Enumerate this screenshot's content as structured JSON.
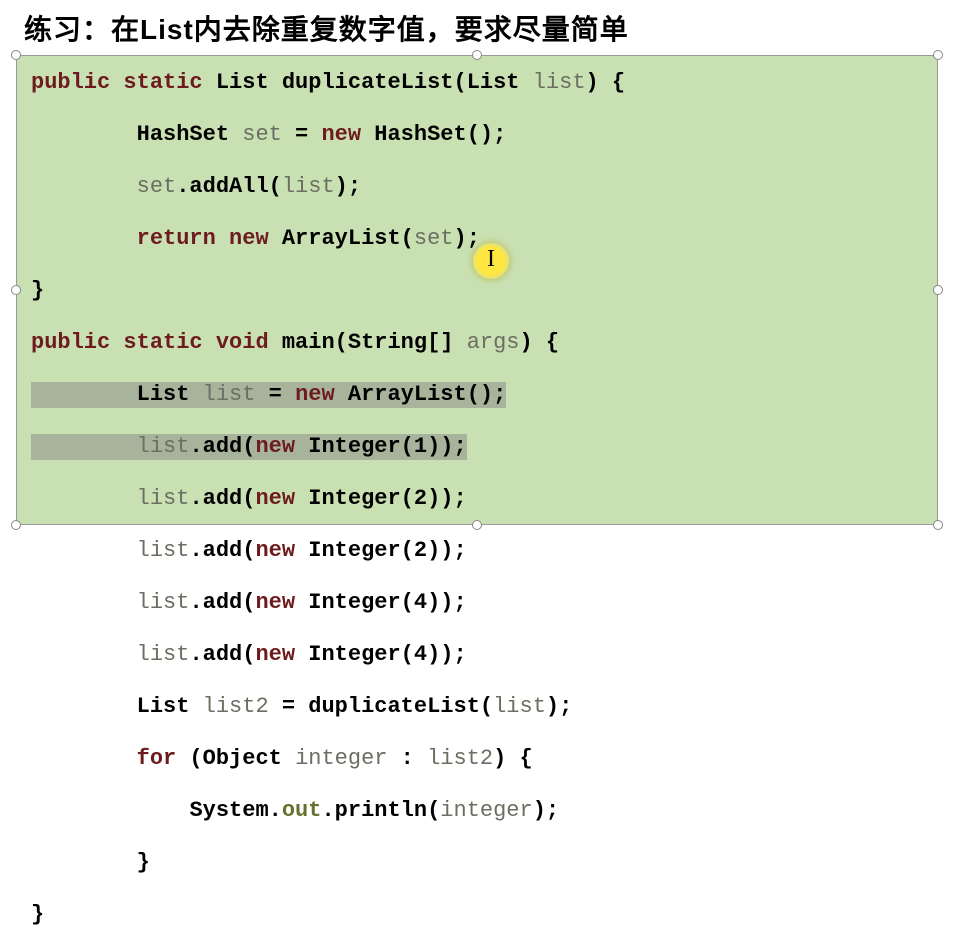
{
  "title": "练习：在List内去除重复数字值，要求尽量简单",
  "code": {
    "l1": {
      "kw1": "public",
      "kw2": "static",
      "type1": "List",
      "name": "duplicateList",
      "lp": "(",
      "type2": "List",
      "param": "list",
      "rp": ") {"
    },
    "l2": {
      "indent": "        ",
      "type": "HashSet",
      "var": "set",
      "eq": " = ",
      "kw": "new",
      "ctor": " HashSet();"
    },
    "l3": {
      "indent": "        ",
      "obj": "set",
      "call": ".addAll(",
      "arg": "list",
      "end": ");"
    },
    "l4": {
      "indent": "        ",
      "kw1": "return",
      "sp": " ",
      "kw2": "new",
      "ctor": " ArrayList(",
      "arg": "set",
      "end": ");"
    },
    "l5": {
      "brace": "}"
    },
    "l6": {
      "kw1": "public",
      "kw2": "static",
      "kw3": "void",
      "name": "main",
      "lp": "(",
      "type": "String[]",
      "param": "args",
      "rp": ") {"
    },
    "l7": {
      "indent": "        ",
      "type": "List",
      "var": "list",
      "eq": " = ",
      "kw": "new",
      "ctor": " ArrayList();"
    },
    "l8": {
      "indent": "        ",
      "obj": "list",
      "call": ".add(",
      "kw": "new",
      "ctor": " Integer(",
      "num": "1",
      "end": "));"
    },
    "l9": {
      "indent": "        ",
      "obj": "list",
      "call": ".add(",
      "kw": "new",
      "ctor": " Integer(",
      "num": "2",
      "end": "));"
    },
    "l10": {
      "indent": "        ",
      "obj": "list",
      "call": ".add(",
      "kw": "new",
      "ctor": " Integer(",
      "num": "2",
      "end": "));"
    },
    "l11": {
      "indent": "        ",
      "obj": "list",
      "call": ".add(",
      "kw": "new",
      "ctor": " Integer(",
      "num": "4",
      "end": "));"
    },
    "l12": {
      "indent": "        ",
      "obj": "list",
      "call": ".add(",
      "kw": "new",
      "ctor": " Integer(",
      "num": "4",
      "end": "));"
    },
    "l13": {
      "indent": "        ",
      "type": "List",
      "var": "list2",
      "eq": " = ",
      "call": "duplicateList(",
      "arg": "list",
      "end": ");"
    },
    "l14": {
      "indent": "        ",
      "kw": "for",
      "lp": " (",
      "type": "Object",
      "var": "integer",
      "colon": " : ",
      "coll": "list2",
      "rp": ") {"
    },
    "l15": {
      "indent": "            ",
      "cls": "System",
      "dot1": ".",
      "field": "out",
      "dot2": ".",
      "method": "println(",
      "arg": "integer",
      "end": ");"
    },
    "l16": {
      "indent": "        ",
      "brace": "}"
    },
    "l17": {
      "brace": "}"
    }
  },
  "icons": {
    "cursor": "text-cursor-icon"
  },
  "colors": {
    "code_bg": "#c9e0b3",
    "keyword": "#6d1b1e",
    "identifier": "#6b6e62",
    "highlight": "#ffe640",
    "selection": "#a7b49b"
  }
}
